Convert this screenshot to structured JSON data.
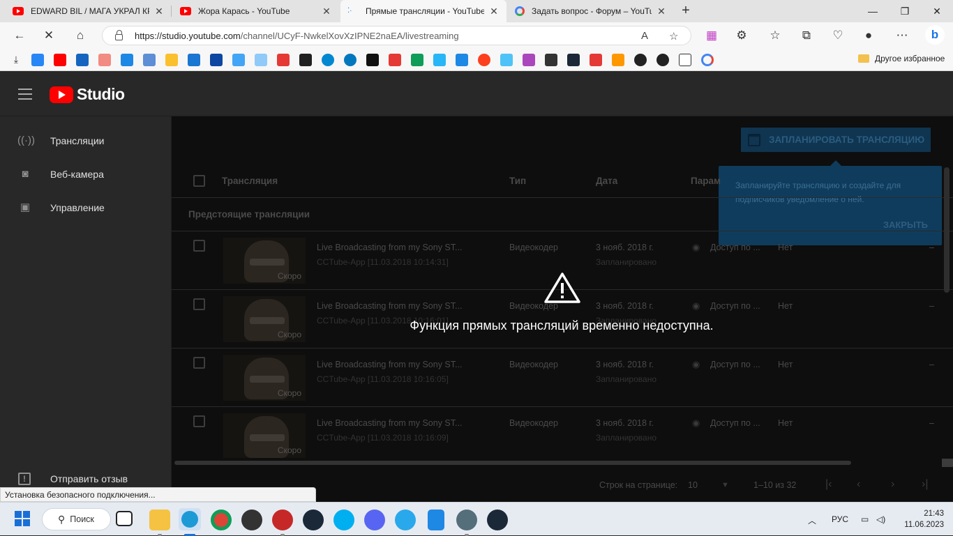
{
  "browser": {
    "tabs": [
      {
        "title": "EDWARD BIL / МАГА УКРАЛ КРА",
        "icon": "youtube-favicon"
      },
      {
        "title": "Жора Карась - YouTube",
        "icon": "youtube-favicon"
      },
      {
        "title": "Прямые трансляции - YouTube",
        "icon": "loading-favicon"
      },
      {
        "title": "Задать вопрос - Форум – YouTu",
        "icon": "google-favicon"
      }
    ],
    "url_base": "https://studio.youtube.com",
    "url_path": "/channel/UCyF-NwkelXovXzIPNE2naEA/livestreaming",
    "other_bookmarks": "Другое избранное",
    "status_text": "Установка безопасного подключения..."
  },
  "studio": {
    "brand": "Studio",
    "nav": [
      {
        "label": "Трансляции",
        "icon": "live-broadcast-icon"
      },
      {
        "label": "Веб-камера",
        "icon": "camera-icon"
      },
      {
        "label": "Управление",
        "icon": "calendar-icon"
      }
    ],
    "feedback": "Отправить отзыв",
    "schedule_button": "ЗАПЛАНИРОВАТЬ ТРАНСЛЯЦИЮ",
    "tooltip": {
      "text": "Запланируйте трансляцию и создайте для подписчиков уведомление о ней.",
      "close": "ЗАКРЫТЬ"
    },
    "table": {
      "headers": [
        "Трансляция",
        "Тип",
        "Дата",
        "Парам"
      ],
      "section": "Предстоящие трансляции",
      "rows": [
        {
          "title": "Live Broadcasting from my Sony ST...",
          "sub": "CCTube-App [11.03.2018 10:14:31]",
          "badge": "Скоро",
          "type": "Видеокодер",
          "date": "3 нояб. 2018 г.",
          "status": "Запланировано",
          "access": "Доступ по ...",
          "flag": "Нет",
          "dash": "–"
        },
        {
          "title": "Live Broadcasting from my Sony ST...",
          "sub": "CCTube-App [11.03.2018 10:16:01]",
          "badge": "Скоро",
          "type": "Видеокодер",
          "date": "3 нояб. 2018 г.",
          "status": "Запланировано",
          "access": "Доступ по ...",
          "flag": "Нет",
          "dash": "–"
        },
        {
          "title": "Live Broadcasting from my Sony ST...",
          "sub": "CCTube-App [11.03.2018 10:16:05]",
          "badge": "Скоро",
          "type": "Видеокодер",
          "date": "3 нояб. 2018 г.",
          "status": "Запланировано",
          "access": "Доступ по ...",
          "flag": "Нет",
          "dash": "–"
        },
        {
          "title": "Live Broadcasting from my Sony ST...",
          "sub": "CCTube-App [11.03.2018 10:16:09]",
          "badge": "Скоро",
          "type": "Видеокодер",
          "date": "3 нояб. 2018 г.",
          "status": "Запланировано",
          "access": "Доступ по ...",
          "flag": "Нет",
          "dash": "–"
        }
      ]
    },
    "pagination": {
      "rows_label": "Строк на странице:",
      "rows_value": "10",
      "range": "1–10 из 32"
    },
    "unavailable_message": "Функция прямых трансляций временно недоступна."
  },
  "taskbar": {
    "search": "Поиск",
    "lang": "РУС",
    "time": "21:43",
    "date": "11.06.2023"
  },
  "colors": {
    "studio_bg": "#282828",
    "accent_red": "#ff0000",
    "tooltip_bg": "#0f3c5c"
  }
}
